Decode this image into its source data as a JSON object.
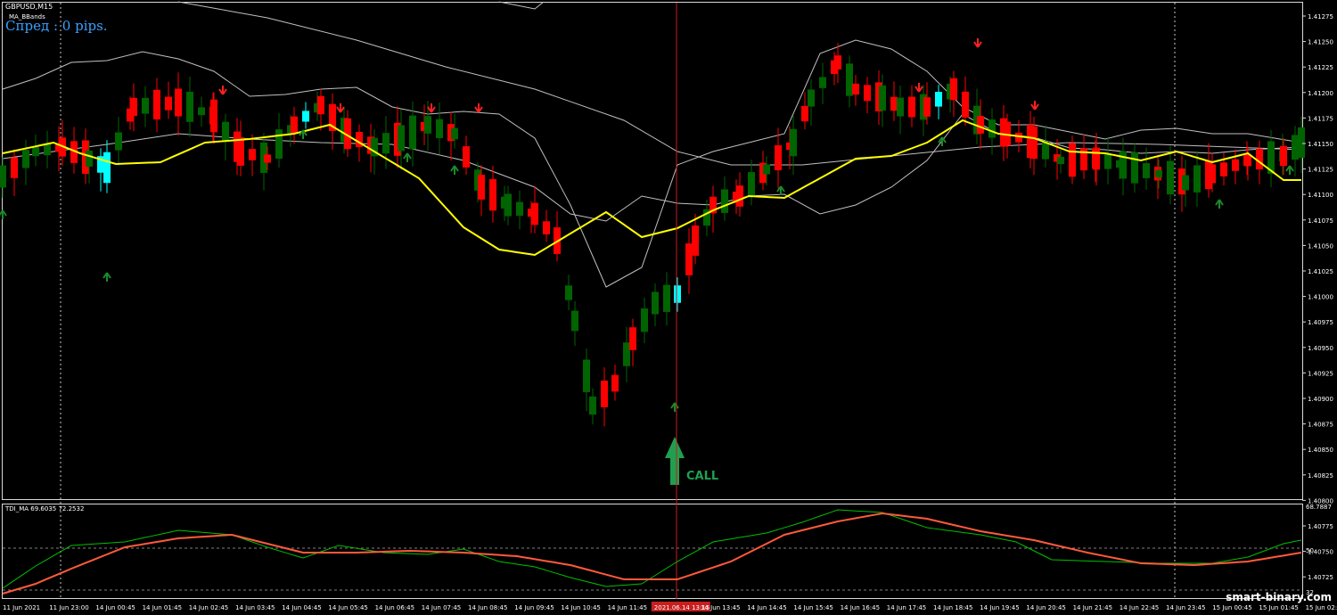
{
  "header": {
    "symbol": "GBPUSD,M15",
    "indicator": "MA_BBands",
    "spread": "Спред : 0 pips."
  },
  "sub_window": {
    "label": "TDI_MA 69.6035 72.2532",
    "scale_labels": [
      "68.7887",
      "50",
      "32"
    ]
  },
  "signal": {
    "label": "CALL"
  },
  "watermark": "smart-binary.com",
  "price_axis": [
    "1.41275",
    "1.41250",
    "1.41225",
    "1.41200",
    "1.41175",
    "1.41150",
    "1.41125",
    "1.41100",
    "1.41075",
    "1.41050",
    "1.41025",
    "1.41000",
    "1.40975",
    "1.40950",
    "1.40925",
    "1.40900",
    "1.40875",
    "1.40850",
    "1.40825",
    "1.40800",
    "1.40775",
    "1.40750",
    "1.40725"
  ],
  "time_axis": [
    "11 Jun 2021",
    "11 Jun 23:00",
    "14 Jun 00:45",
    "14 Jun 01:45",
    "14 Jun 02:45",
    "14 Jun 03:45",
    "14 Jun 04:45",
    "14 Jun 05:45",
    "14 Jun 06:45",
    "14 Jun 07:45",
    "14 Jun 08:45",
    "14 Jun 09:45",
    "14 Jun 10:45",
    "14 Jun 11:45",
    "2021.06.14 13:15",
    "14 Jun 13:45",
    "14 Jun 14:45",
    "14 Jun 15:45",
    "14 Jun 16:45",
    "14 Jun 17:45",
    "14 Jun 18:45",
    "14 Jun 19:45",
    "14 Jun 20:45",
    "14 Jun 21:45",
    "14 Jun 22:45",
    "14 Jun 23:45",
    "15 Jun 00:45",
    "15 Jun 01:45",
    "15 Jun 02:45"
  ],
  "colors": {
    "bull": "#006400",
    "bear": "#ff0000",
    "signal_candle": "#00ffff",
    "ma": "#ffff00",
    "bands": "#c0c0c0",
    "tdi_fast": "#00c000",
    "tdi_slow": "#ff5a3c",
    "crosshair": "#c81e1e",
    "call_arrow": "#1fa050"
  }
}
